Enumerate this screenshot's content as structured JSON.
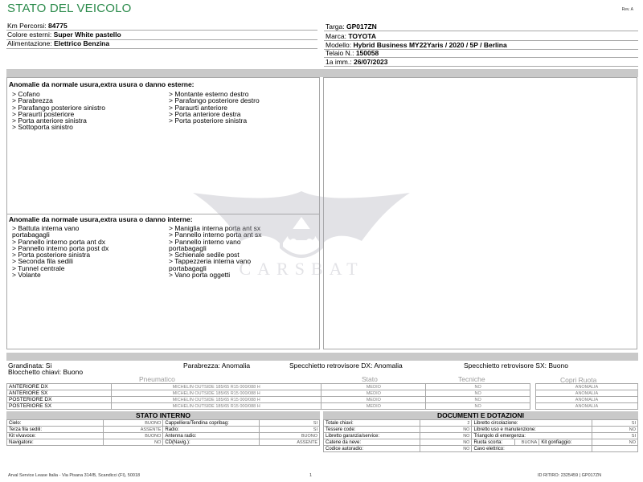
{
  "header": {
    "title": "STATO DEL VEICOLO",
    "rev": "Rev. A"
  },
  "vehicle": {
    "km_label": "Km Percorsi:",
    "km_value": "84775",
    "color_label": "Colore esterni:",
    "color_value": "Super White pastello",
    "fuel_label": "Alimentazione:",
    "fuel_value": "Elettrico Benzina",
    "plate_label": "Targa:",
    "plate_value": "GP017ZN",
    "brand_label": "Marca:",
    "brand_value": "TOYOTA",
    "model_label": "Modello:",
    "model_value": "Hybrid Business MY22Yaris / 2020 / 5P / Berlina",
    "chassis_label": "Telaio N.:",
    "chassis_value": "150058",
    "reg_label": "1a imm.:",
    "reg_value": "26/07/2023"
  },
  "external": {
    "title": "Anomalie da normale usura,extra usura o danno esterne:",
    "col1": [
      "> Cofano",
      "> Parabrezza",
      "> Parafango posteriore sinistro",
      "> Paraurti posteriore",
      "> Porta anteriore sinistra",
      "> Sottoporta sinistro"
    ],
    "col2": [
      "> Montante esterno destro",
      "> Parafango posteriore destro",
      "> Paraurti anteriore",
      "> Porta anteriore destra",
      "> Porta posteriore sinistra"
    ]
  },
  "internal": {
    "title": "Anomalie da normale usura,extra usura o danno interne:",
    "col1": [
      "> Battuta interna vano",
      "portabagagli",
      "> Pannello interno porta ant dx",
      "> Pannello interno porta post dx",
      "> Porta posteriore sinistra",
      "> Seconda fila sedili",
      "> Tunnel centrale",
      "> Volante"
    ],
    "col2": [
      "> Maniglia interna porta ant sx",
      "> Pannello interno porta ant sx",
      "> Pannello interno vano",
      "portabagagli",
      "> Schienale sedile post",
      "> Tappezzeria interna vano",
      "portabagagli",
      "> Vano porta oggetti"
    ]
  },
  "watermark": {
    "text": "CARSBAT"
  },
  "summary": {
    "hail": "Grandinata: Si",
    "windshield": "Parabrezza: Anomalia",
    "mirror_dx": "Specchietto retrovisore DX: Anomalia",
    "mirror_sx": "Specchietto retrovisore SX: Buono",
    "key_block": "Blocchetto chiavi: Buono"
  },
  "tires": {
    "headers": [
      "Pneumatico",
      "Stato",
      "Tecniche",
      "Copri Ruota"
    ],
    "rows": [
      {
        "pos": "ANTERIORE DX",
        "tire": "MICHELIN OUTSIDE 185/65 R15 000/088 H",
        "state": "MEDIO",
        "tech": "NO",
        "cover": "ANOMALIA"
      },
      {
        "pos": "ANTERIORE SX",
        "tire": "MICHELIN OUTSIDE 185/65 R15 000/088 H",
        "state": "MEDIO",
        "tech": "NO",
        "cover": "ANOMALIA"
      },
      {
        "pos": "POSTERIORE DX",
        "tire": "MICHELIN OUTSIDE 185/65 R15 000/088 H",
        "state": "MEDIO",
        "tech": "NO",
        "cover": "ANOMALIA"
      },
      {
        "pos": "POSTERIORE SX",
        "tire": "MICHELIN OUTSIDE 185/65 R15 000/088 H",
        "state": "MEDIO",
        "tech": "NO",
        "cover": "ANOMALIA"
      }
    ]
  },
  "stato_interno": {
    "title": "STATO INTERNO",
    "rows": [
      {
        "l1": "Cielo:",
        "v1": "BUONO",
        "l2": "Cappelliera/Tendina copribag:",
        "v2": "SI"
      },
      {
        "l1": "Terza fila sedili:",
        "v1": "ASSENTE",
        "l2": "Radio:",
        "v2": "SI"
      },
      {
        "l1": "Kit vivavoce:",
        "v1": "BUONO",
        "l2": "Antenna radio:",
        "v2": "BUONO"
      },
      {
        "l1": "Navigatore:",
        "v1": "NO",
        "l2": "CD(Navig.):",
        "v2": "ASSENTE"
      }
    ]
  },
  "documenti": {
    "title": "DOCUMENTI E DOTAZIONI",
    "rows": [
      {
        "l1": "Totale chiavi:",
        "v1": "2",
        "l2": "Libretto circolazione:",
        "v2": "SI"
      },
      {
        "l1": "Tessere code:",
        "v1": "NO",
        "l2": "Libretto uso e manutenzione:",
        "v2": "NO"
      },
      {
        "l1": "Libretto garanzia/service:",
        "v1": "NO",
        "l2": "Triangolo di emergenza:",
        "v2": "SI"
      },
      {
        "l1": "Catene da neve:",
        "v1": "NO",
        "l2": "Ruota scorta:",
        "v2": "BUONA",
        "l3": "Kit gonfiaggio:",
        "v3": "NO"
      },
      {
        "l1": "Codice autoradio:",
        "v1": "NO",
        "l2": "Cavo elettrico:",
        "v2": ""
      }
    ]
  },
  "footer": {
    "company": "Arval Service Lease Italia - Via Pisana 314/B, Scandicci (FI), 50018",
    "page": "1",
    "id": "ID RITIRO: 2325459 | GP017ZN"
  }
}
